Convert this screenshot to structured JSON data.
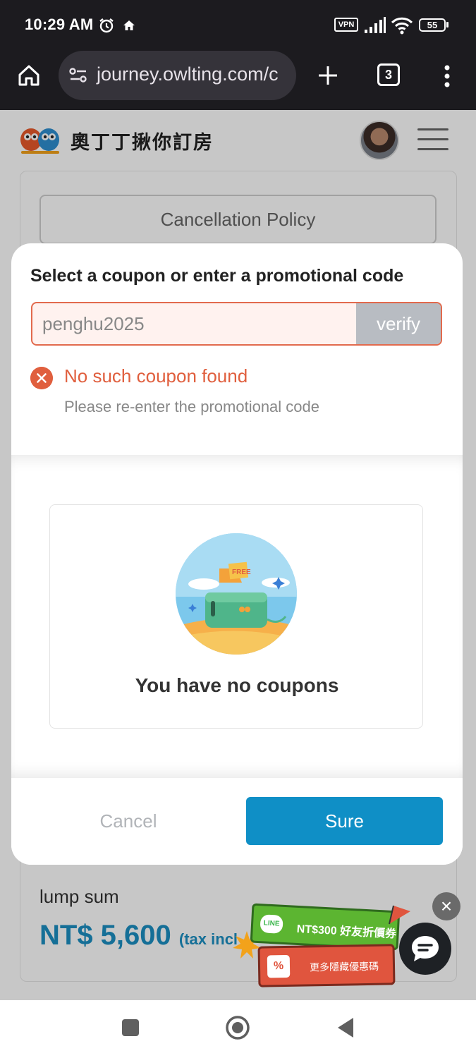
{
  "status_bar": {
    "time": "10:29 AM",
    "vpn": "VPN",
    "battery": "55"
  },
  "browser": {
    "url": "journey.owlting.com/c",
    "tab_count": "3"
  },
  "site": {
    "brand_name": "奧丁丁揪你訂房"
  },
  "page": {
    "cancellation_policy_label": "Cancellation Policy",
    "lump_sum_label": "lump sum",
    "total_price": "NT$ 5,600",
    "tax_note": "(tax incl"
  },
  "coupon_modal": {
    "title": "Select a coupon or enter a promotional code",
    "code_value": "penghu2025",
    "verify_label": "verify",
    "error_title": "No such coupon found",
    "error_hint": "Please re-enter the promotional code",
    "illustration_tag": "FREE",
    "empty_message": "You have no coupons",
    "cancel_label": "Cancel",
    "sure_label": "Sure"
  },
  "promo_banner": {
    "line_label": "LINE",
    "friend_coupon": "NT$300 好友折價券",
    "gift_symbol": "%",
    "hidden_deals": "更多隱藏優惠碼"
  },
  "colors": {
    "accent_blue": "#0f8fc6",
    "error_red": "#e05f3e",
    "verify_gray": "#b8bcc2"
  }
}
